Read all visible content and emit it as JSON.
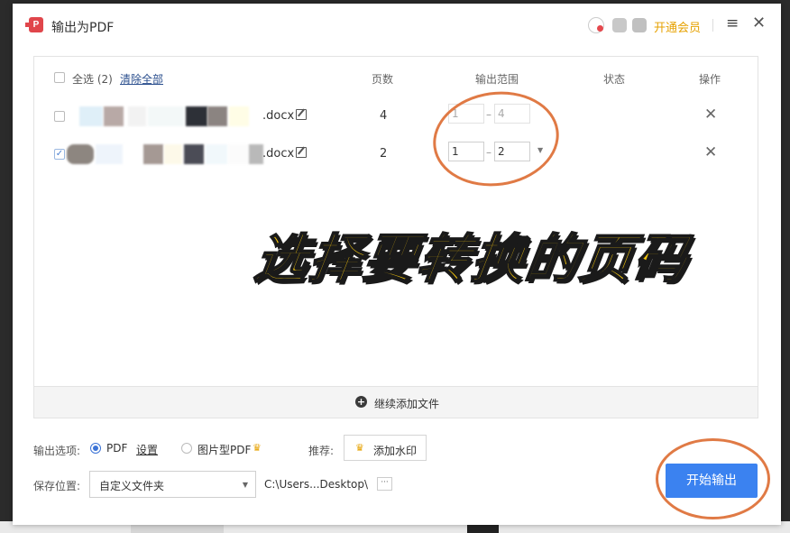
{
  "window": {
    "title": "输出为PDF",
    "vip_label": "开通会员",
    "menu_icon": "hamburger-icon",
    "close_icon": "close-icon"
  },
  "table": {
    "select_all": "全选 (2)",
    "clear_all": "清除全部",
    "columns": [
      "页数",
      "输出范围",
      "状态",
      "操作"
    ],
    "rows": [
      {
        "checked": false,
        "filename_suffix": ".docx",
        "pages": "4",
        "range_from": "1",
        "range_to": "4",
        "range_enabled": false,
        "status": ""
      },
      {
        "checked": true,
        "filename_suffix": ".docx",
        "pages": "2",
        "range_from": "1",
        "range_to": "2",
        "range_enabled": true,
        "status": ""
      }
    ]
  },
  "overlay_text": "选择要转换的页码",
  "add_file_label": "继续添加文件",
  "options": {
    "label": "输出选项:",
    "pdf_label": "PDF",
    "settings_label": "设置",
    "image_pdf_label": "图片型PDF",
    "recommend_label": "推荐:",
    "watermark_label": "添加水印"
  },
  "save": {
    "label": "保存位置:",
    "folder_option": "自定义文件夹",
    "path": "C:\\Users...Desktop\\",
    "browse_label": "···"
  },
  "start_button": "开始输出",
  "colors": {
    "accent": "#3b82f0",
    "vip": "#e6a100",
    "annotation": "#f1c40f",
    "highlight_circle": "#e07a45"
  }
}
